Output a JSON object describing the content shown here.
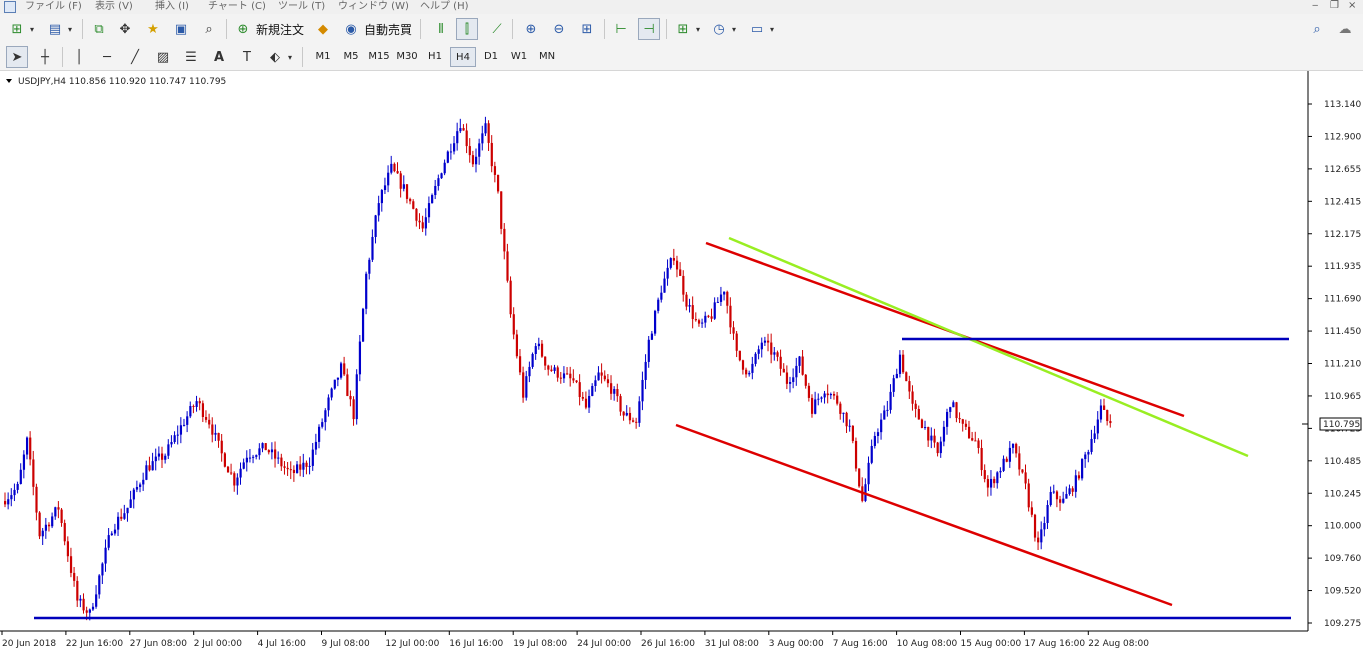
{
  "menu": {
    "items": [
      "ファイル (F)",
      "表示 (V)",
      "挿入 (I)",
      "チャート (C)",
      "ツール (T)",
      "ウィンドウ (W)",
      "ヘルプ (H)"
    ]
  },
  "toolbar": {
    "new_order_label": "新規注文",
    "auto_trade_label": "自動売買",
    "timeframes": [
      "M1",
      "M5",
      "M15",
      "M30",
      "H1",
      "H4",
      "D1",
      "W1",
      "MN"
    ],
    "active_timeframe": "H4",
    "icons": [
      "new-chart-icon",
      "profiles-icon",
      "market-watch-icon",
      "navigator-icon",
      "favorites-icon",
      "terminal-icon",
      "strategy-tester-icon",
      "bar-chart-icon",
      "candlestick-icon",
      "line-chart-icon",
      "zoom-in-icon",
      "zoom-out-icon",
      "tile-windows-icon",
      "auto-scroll-icon",
      "chart-shift-icon",
      "indicators-icon",
      "periods-icon",
      "templates-icon",
      "search-icon",
      "chat-icon"
    ],
    "draw_icons": [
      "cursor-icon",
      "crosshair-icon",
      "vertical-line-icon",
      "horizontal-line-icon",
      "trendline-icon",
      "fibonacci-channel-icon",
      "fibonacci-icon",
      "text-icon",
      "text-label-icon",
      "arrows-icon"
    ]
  },
  "chart_data": {
    "type": "candlestick",
    "symbol_info": "USDJPY,H4  110.856 110.920 110.747 110.795",
    "current_price": "110.795",
    "y_ticks": [
      "113.140",
      "112.900",
      "112.655",
      "112.415",
      "112.175",
      "111.935",
      "111.690",
      "111.450",
      "111.210",
      "110.965",
      "110.725",
      "110.485",
      "110.245",
      "110.000",
      "109.760",
      "109.520",
      "109.275"
    ],
    "x_ticks": [
      "20 Jun 2018",
      "22 Jun 16:00",
      "27 Jun 08:00",
      "2 Jul 00:00",
      "4 Jul 16:00",
      "9 Jul 08:00",
      "12 Jul 00:00",
      "16 Jul 16:00",
      "19 Jul 08:00",
      "24 Jul 00:00",
      "26 Jul 16:00",
      "31 Jul 08:00",
      "3 Aug 00:00",
      "7 Aug 16:00",
      "10 Aug 08:00",
      "15 Aug 00:00",
      "17 Aug 16:00",
      "22 Aug 08:00"
    ],
    "ylim": [
      109.26,
      113.3
    ],
    "up_color": "#0000cc",
    "down_color": "#cc0000",
    "waypoints": [
      [
        0,
        110.2
      ],
      [
        5,
        110.3
      ],
      [
        8,
        110.65
      ],
      [
        12,
        109.95
      ],
      [
        18,
        110.15
      ],
      [
        24,
        109.45
      ],
      [
        28,
        109.35
      ],
      [
        35,
        110.0
      ],
      [
        40,
        110.15
      ],
      [
        46,
        110.45
      ],
      [
        52,
        110.55
      ],
      [
        58,
        110.8
      ],
      [
        62,
        110.95
      ],
      [
        66,
        110.8
      ],
      [
        70,
        110.55
      ],
      [
        74,
        110.35
      ],
      [
        78,
        110.55
      ],
      [
        84,
        110.6
      ],
      [
        88,
        110.5
      ],
      [
        92,
        110.4
      ],
      [
        98,
        110.5
      ],
      [
        104,
        110.95
      ],
      [
        108,
        111.2
      ],
      [
        112,
        110.85
      ],
      [
        116,
        111.9
      ],
      [
        120,
        112.45
      ],
      [
        124,
        112.7
      ],
      [
        128,
        112.55
      ],
      [
        134,
        112.25
      ],
      [
        140,
        112.7
      ],
      [
        146,
        113.05
      ],
      [
        150,
        112.75
      ],
      [
        154,
        113.0
      ],
      [
        158,
        112.5
      ],
      [
        162,
        111.6
      ],
      [
        166,
        111.0
      ],
      [
        170,
        111.4
      ],
      [
        174,
        111.2
      ],
      [
        178,
        111.15
      ],
      [
        182,
        111.1
      ],
      [
        186,
        110.9
      ],
      [
        190,
        111.15
      ],
      [
        194,
        111.05
      ],
      [
        198,
        110.85
      ],
      [
        202,
        110.8
      ],
      [
        206,
        111.4
      ],
      [
        210,
        111.8
      ],
      [
        214,
        112.05
      ],
      [
        218,
        111.7
      ],
      [
        222,
        111.5
      ],
      [
        226,
        111.6
      ],
      [
        230,
        111.8
      ],
      [
        234,
        111.3
      ],
      [
        238,
        111.15
      ],
      [
        242,
        111.4
      ],
      [
        246,
        111.3
      ],
      [
        250,
        111.1
      ],
      [
        254,
        111.25
      ],
      [
        258,
        110.9
      ],
      [
        262,
        111.05
      ],
      [
        266,
        110.95
      ],
      [
        270,
        110.75
      ],
      [
        274,
        110.2
      ],
      [
        278,
        110.7
      ],
      [
        282,
        110.9
      ],
      [
        286,
        111.3
      ],
      [
        290,
        110.9
      ],
      [
        294,
        110.75
      ],
      [
        298,
        110.55
      ],
      [
        302,
        110.95
      ],
      [
        306,
        110.75
      ],
      [
        310,
        110.65
      ],
      [
        314,
        110.3
      ],
      [
        318,
        110.45
      ],
      [
        322,
        110.6
      ],
      [
        326,
        110.3
      ],
      [
        330,
        109.85
      ],
      [
        334,
        110.25
      ],
      [
        338,
        110.2
      ],
      [
        342,
        110.35
      ],
      [
        346,
        110.6
      ],
      [
        350,
        110.9
      ],
      [
        352,
        110.8
      ]
    ]
  },
  "drawings": {
    "red_channel_upper": {
      "color": "#dd0000"
    },
    "red_channel_lower": {
      "color": "#dd0000"
    },
    "green_trendline": {
      "color": "#99ee22"
    },
    "blue_resistance": {
      "color": "#0000bb"
    },
    "blue_support": {
      "color": "#0000bb"
    }
  }
}
